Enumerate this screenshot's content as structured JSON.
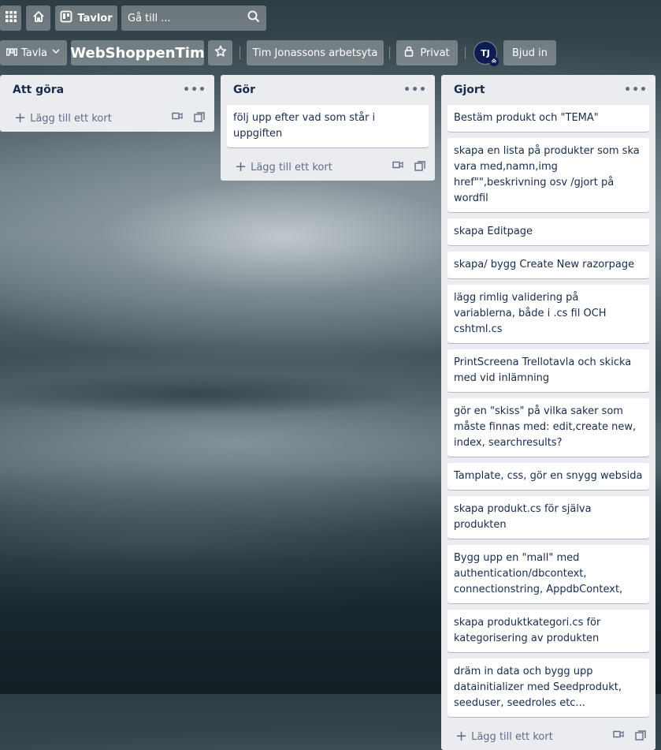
{
  "topbar": {
    "apps_icon": "grid-icon",
    "home_icon": "home-icon",
    "boards_label": "Tavlor",
    "search_placeholder": "Gå till ...",
    "search_icon": "search-icon"
  },
  "board": {
    "view_label": "Tavla",
    "title": "WebShoppenTim",
    "workspace": "Tim Jonassons arbetsyta",
    "visibility": "Privat",
    "avatar_initials": "TJ",
    "invite_label": "Bjud in"
  },
  "lists": [
    {
      "title": "Att göra",
      "cards": [],
      "add_label": "Lägg till ett kort"
    },
    {
      "title": "Gör",
      "cards": [
        "följ upp efter vad som står i uppgiften"
      ],
      "add_label": "Lägg till ett kort"
    },
    {
      "title": "Gjort",
      "cards": [
        "Bestäm produkt och \"TEMA\"",
        "skapa en lista på produkter som ska vara med,namn,img href\"\",beskrivning osv /gjort på wordfil",
        "skapa Editpage",
        "skapa/ bygg Create New razorpage",
        "lägg rimlig validering på variablerna, både i .cs fil OCH cshtml.cs",
        "PrintScreena Trellotavla och skicka med vid inlämning",
        "gör en \"skiss\" på vilka saker som måste finnas med: edit,create new, index, searchresults?",
        "Tamplate, css, gör en snygg websida",
        "skapa produkt.cs för själva produkten",
        "Bygg upp en \"mall\" med authentication/dbcontext, connectionstring, AppdbContext,",
        "skapa produktkategori.cs för kategorisering av produkten",
        "dräm in data och bygg upp datainitializer med Seedprodukt, seeduser, seedroles etc..."
      ],
      "add_label": "Lägg till ett kort"
    }
  ]
}
